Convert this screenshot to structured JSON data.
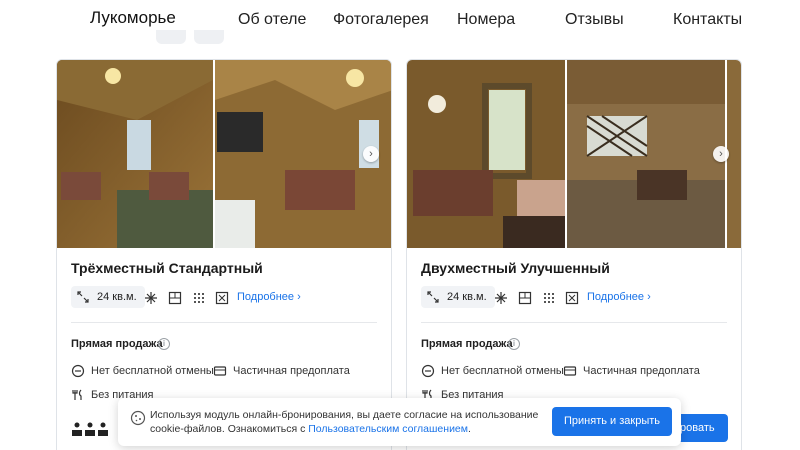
{
  "header": {
    "logo": "Лукоморье",
    "nav": [
      {
        "label": "Об отеле"
      },
      {
        "label": "Фотогалерея"
      },
      {
        "label": "Номера"
      },
      {
        "label": "Отзывы"
      },
      {
        "label": "Контакты"
      }
    ]
  },
  "rooms": [
    {
      "title": "Трёхместный Стандартный",
      "area": "24 кв.м.",
      "more": "Подробнее",
      "sale_title": "Прямая продажа",
      "cancel": "Нет бесплатной отмены",
      "payment": "Частичная предоплата",
      "meals": "Без питания"
    },
    {
      "title": "Двухместный Улучшенный",
      "area": "24 кв.м.",
      "more": "Подробнее",
      "sale_title": "Прямая продажа",
      "cancel": "Нет бесплатной отмены",
      "payment": "Частичная предоплата",
      "meals": "Без питания",
      "book_label_visible": "ровать"
    }
  ],
  "cookie": {
    "text_before": "Используя модуль онлайн-бронирования, вы даете согласие на использование cookie-файлов. Ознакомиться с ",
    "link": "Пользовательским соглашением",
    "text_after": ".",
    "accept": "Принять и закрыть"
  },
  "colors": {
    "accent": "#1a73e8",
    "border": "#dfe3e8",
    "chip": "#f1f3f6"
  },
  "icons": [
    "expand-arrows-icon",
    "snowflake-icon",
    "bed-icon",
    "window-grid-icon",
    "fridge-icon",
    "chevron-right-icon",
    "info-icon",
    "no-cancel-icon",
    "card-icon",
    "fork-knife-icon",
    "guest-icon",
    "cookie-icon"
  ]
}
